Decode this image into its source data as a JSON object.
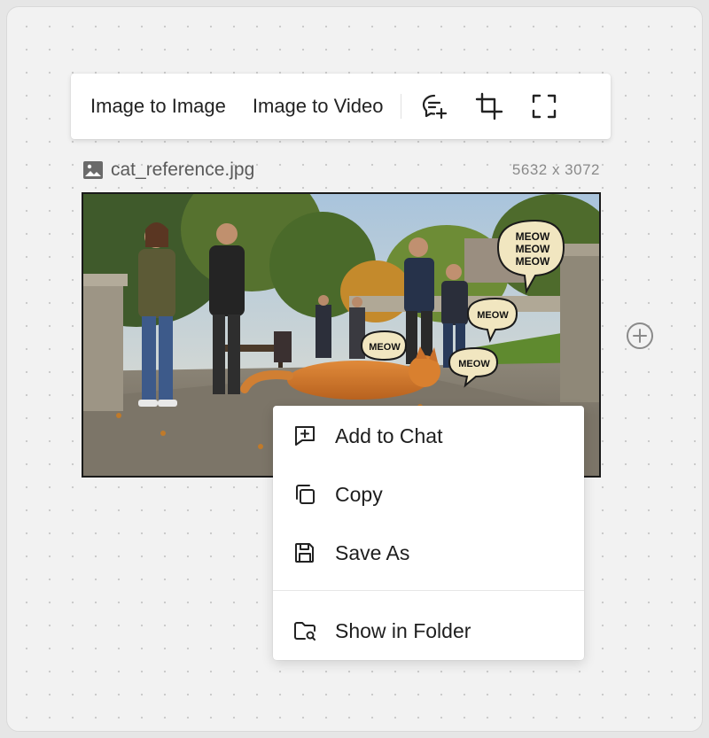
{
  "toolbar": {
    "image_to_image": "Image to Image",
    "image_to_video": "Image to Video",
    "icons": [
      "chat-add-icon",
      "crop-icon",
      "fullscreen-icon"
    ]
  },
  "file": {
    "name": "cat_reference.jpg",
    "dimensions": "5632 x 3072"
  },
  "photo": {
    "speech_bubbles": [
      "MEOW\nMEOW\nMEOW",
      "MEOW",
      "MEOW",
      "MEOW"
    ]
  },
  "context_menu": {
    "items": [
      {
        "label": "Add to Chat",
        "icon": "chat-plus-icon"
      },
      {
        "label": "Copy",
        "icon": "copy-icon"
      },
      {
        "label": "Save As",
        "icon": "save-icon"
      },
      {
        "label": "Show in Folder",
        "icon": "folder-search-icon"
      }
    ]
  },
  "colors": {
    "canvas_bg": "#f2f2f2",
    "text_primary": "#1e1e1e",
    "text_muted": "#8a8a8a"
  }
}
